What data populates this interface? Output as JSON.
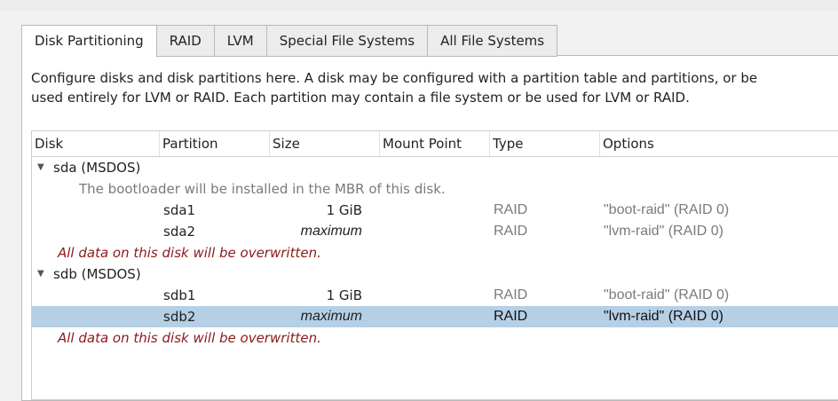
{
  "tabs": [
    "Disk Partitioning",
    "RAID",
    "LVM",
    "Special File Systems",
    "All File Systems"
  ],
  "description": [
    "Configure disks and disk partitions here.  A disk may be configured with a partition table and partitions, or be",
    "used entirely for LVM or RAID.  Each partition may contain a file system or be used for LVM or RAID."
  ],
  "columns": {
    "disk": "Disk",
    "partition": "Partition",
    "size": "Size",
    "mount_point": "Mount Point",
    "type": "Type",
    "options": "Options"
  },
  "icons": {
    "expander": "triangle-down-icon"
  },
  "disks": [
    {
      "name": "sda (MSDOS)",
      "note": "The bootloader will be installed in the MBR of this disk.",
      "partitions": [
        {
          "name": "sda1",
          "size": "1  GiB",
          "type": "RAID",
          "options": "\"boot-raid\" (RAID 0)"
        },
        {
          "name": "sda2",
          "size": "maximum",
          "type": "RAID",
          "options": "\"lvm-raid\" (RAID 0)"
        }
      ],
      "warning": "All data on this disk will be overwritten."
    },
    {
      "name": "sdb (MSDOS)",
      "partitions": [
        {
          "name": "sdb1",
          "size": "1  GiB",
          "type": "RAID",
          "options": "\"boot-raid\" (RAID 0)"
        },
        {
          "name": "sdb2",
          "size": "maximum",
          "type": "RAID",
          "options": "\"lvm-raid\" (RAID 0)"
        }
      ],
      "warning": "All data on this disk will be overwritten."
    }
  ],
  "colors": {
    "selected_row": "#b5cfe5",
    "warning_text": "#8b1a1a",
    "dim_text": "#7a7a7a"
  }
}
